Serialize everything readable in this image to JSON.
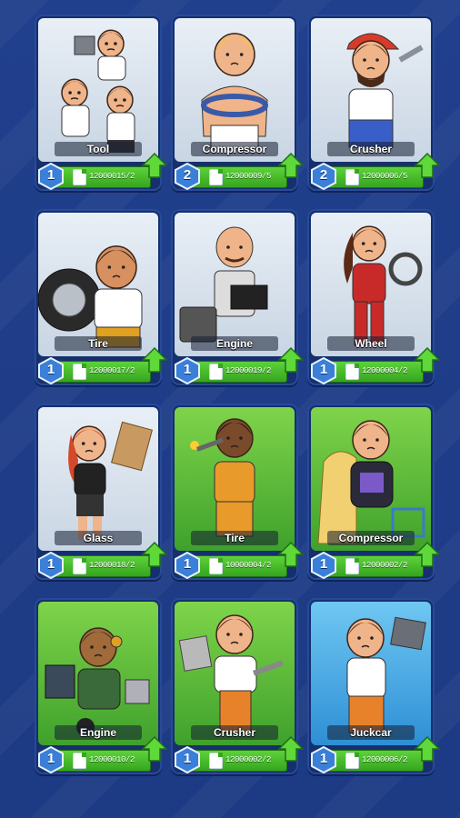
{
  "colors": {
    "background": "#1f3c88",
    "bar_green": "#45b92a",
    "badge_blue": "#3a7fd8",
    "portrait_gray": "#dbe4ee",
    "portrait_green": "#5fbf3c",
    "portrait_blue": "#4aa8e6"
  },
  "cards": [
    {
      "name": "Tool",
      "level": "1",
      "count": "12000015/2",
      "bg": "gray",
      "figure": "three-workers"
    },
    {
      "name": "Compressor",
      "level": "2",
      "count": "12000009/5",
      "bg": "gray",
      "figure": "blonde-strongman"
    },
    {
      "name": "Crusher",
      "level": "2",
      "count": "12000006/5",
      "bg": "gray",
      "figure": "red-cap-mechanic"
    },
    {
      "name": "Tire",
      "level": "1",
      "count": "12000017/2",
      "bg": "gray",
      "figure": "tire-worker"
    },
    {
      "name": "Engine",
      "level": "1",
      "count": "12000019/2",
      "bg": "gray",
      "figure": "bald-engineer"
    },
    {
      "name": "Wheel",
      "level": "1",
      "count": "12000004/2",
      "bg": "gray",
      "figure": "racing-girl"
    },
    {
      "name": "Glass",
      "level": "1",
      "count": "12000018/2",
      "bg": "gray",
      "figure": "redhead-worker"
    },
    {
      "name": "Tire",
      "level": "1",
      "count": "10000004/2",
      "bg": "green",
      "figure": "welder"
    },
    {
      "name": "Compressor",
      "level": "1",
      "count": "12000002/2",
      "bg": "green",
      "figure": "caped-worker"
    },
    {
      "name": "Engine",
      "level": "1",
      "count": "12000010/2",
      "bg": "green",
      "figure": "cyborg-mechanic"
    },
    {
      "name": "Crusher",
      "level": "1",
      "count": "12000002/2",
      "bg": "green",
      "figure": "orange-overall-worker"
    },
    {
      "name": "Juckcar",
      "level": "1",
      "count": "12000006/2",
      "bg": "blue",
      "figure": "hammer-worker"
    }
  ],
  "icons": {
    "level_badge": "hexagon-badge-icon",
    "card_count": "card-stack-icon",
    "upgrade": "upgrade-arrow-icon"
  }
}
